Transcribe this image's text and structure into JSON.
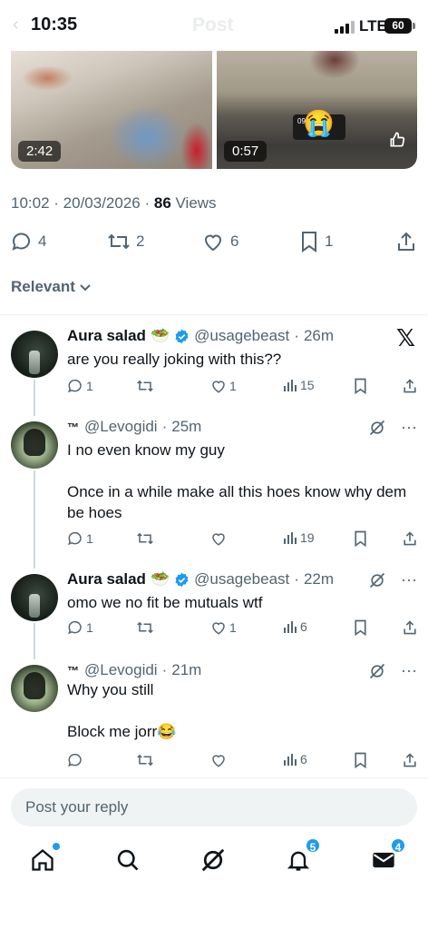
{
  "status": {
    "time": "10:35",
    "network": "LTE",
    "battery": "60",
    "ghost_title": "Post"
  },
  "media": [
    {
      "duration": "2:42"
    },
    {
      "duration": "0:57",
      "plate_text": "09 53",
      "emoji": "😭"
    }
  ],
  "post_meta": {
    "time": "10:02",
    "date": "20/03/2026",
    "views_count": "86",
    "views_label": "Views"
  },
  "actions": {
    "replies": "4",
    "reposts": "2",
    "likes": "6",
    "bookmarks": "1"
  },
  "sort": {
    "label": "Relevant"
  },
  "replies": [
    {
      "name": "Aura salad",
      "name_emoji": "🥗",
      "verified": true,
      "handle": "@usagebeast",
      "time": "26m",
      "text": "are you really joking with this??",
      "stats": {
        "replies": "1",
        "reposts": "",
        "likes": "1",
        "views": "15"
      }
    },
    {
      "name": "™",
      "handle": "@Levogidi",
      "time": "25m",
      "text_lines": [
        "I no even know my guy",
        "",
        "Once in a while make all this hoes know why dem be hoes"
      ],
      "stats": {
        "replies": "1",
        "reposts": "",
        "likes": "",
        "views": "19"
      }
    },
    {
      "name": "Aura salad",
      "name_emoji": "🥗",
      "verified": true,
      "handle": "@usagebeast",
      "time": "22m",
      "text": "omo we no fit be mutuals wtf",
      "stats": {
        "replies": "1",
        "reposts": "",
        "likes": "1",
        "views": "6"
      }
    },
    {
      "name": "™",
      "handle": "@Levogidi",
      "time": "21m",
      "text_lines": [
        "Why you still",
        "",
        "Block me jorr😂"
      ],
      "stats": {
        "replies": "",
        "reposts": "",
        "likes": "",
        "views": "6"
      }
    }
  ],
  "reply_input": {
    "placeholder": "Post your reply"
  },
  "nav": {
    "notifications_badge": "5",
    "messages_badge": "4"
  },
  "colors": {
    "accent": "#1d9bf0",
    "verified": "#1d9bf0",
    "text_secondary": "#536471"
  }
}
